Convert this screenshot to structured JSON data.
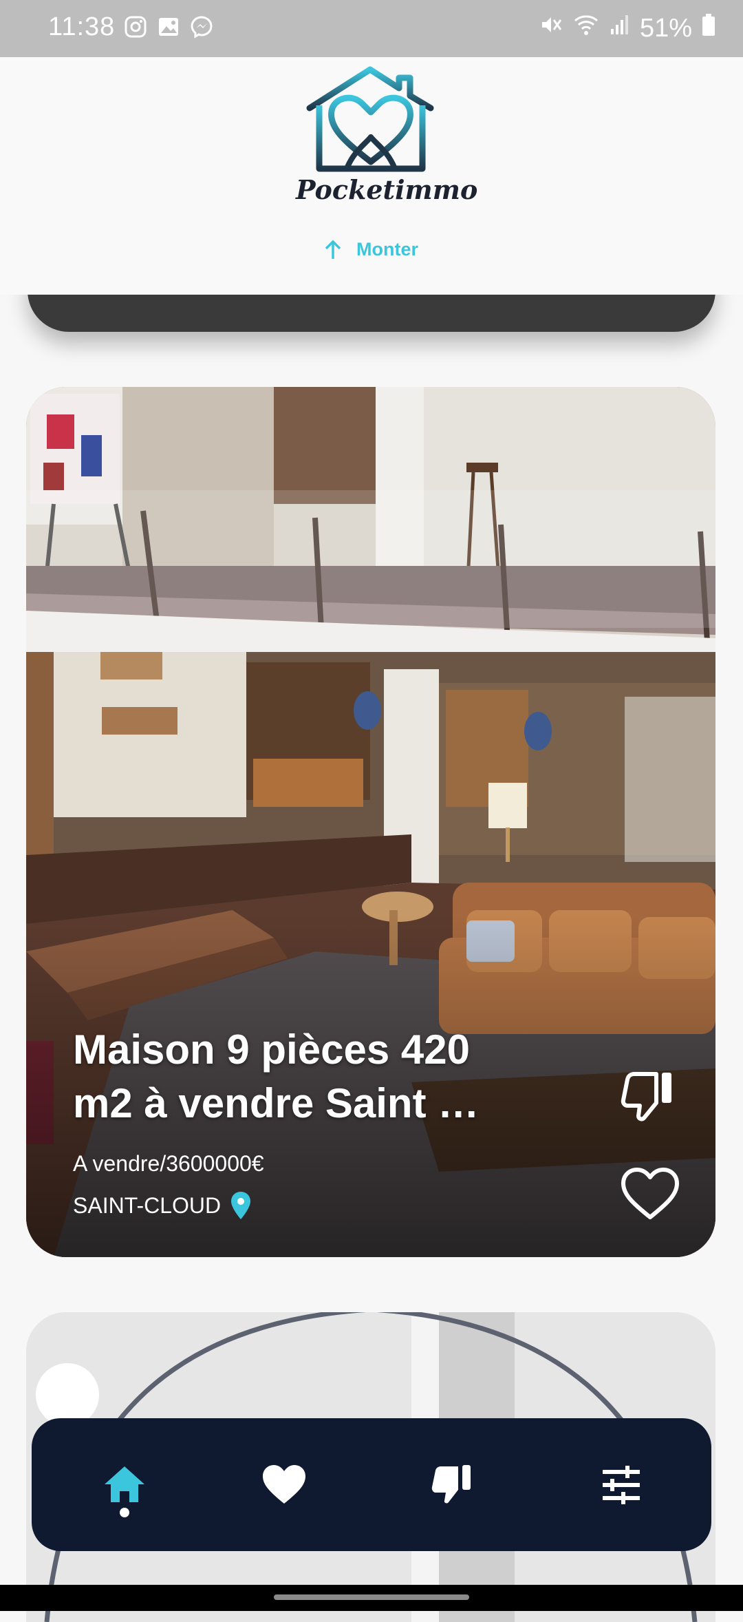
{
  "status_bar": {
    "time": "11:38",
    "battery": "51%",
    "icons_left": [
      "instagram-icon",
      "gallery-icon",
      "messenger-icon"
    ],
    "icons_right": [
      "mute-icon",
      "wifi-icon",
      "signal-icon",
      "battery-icon"
    ]
  },
  "header": {
    "logo_text": "Pocketimmo",
    "scroll_up_label": "Monter"
  },
  "listing": {
    "title": "Maison 9 pièces 420 m2 à vendre Saint …",
    "price": "A vendre/3600000€",
    "city": "SAINT-CLOUD"
  },
  "nav": {
    "items": [
      "home-icon",
      "heart-icon",
      "thumbs-down-icon",
      "filters-icon"
    ],
    "active": "home"
  },
  "colors": {
    "accent": "#3cc6de",
    "nav_bg": "#0f1930",
    "status_bg": "#bdbdbd"
  }
}
